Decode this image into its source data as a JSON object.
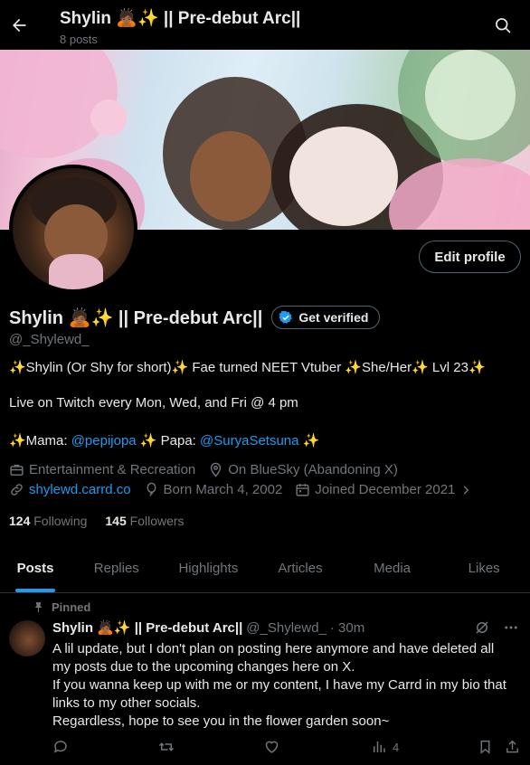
{
  "header": {
    "title": "Shylin 🙇🏾✨ || Pre-debut Arc||",
    "post_count": "8 posts"
  },
  "profile": {
    "edit_label": "Edit profile",
    "display_name": "Shylin 🙇🏾✨ || Pre-debut Arc||",
    "verify_label": "Get verified",
    "handle": "@_Shylewd_",
    "bio": {
      "line1": "✨Shylin (Or Shy for short)✨ Fae turned NEET Vtuber ✨She/Her✨ Lvl 23✨",
      "line2": "Live on Twitch every Mon, Wed, and Fri @ 4 pm",
      "line3_prefix": "✨Mama: ",
      "mama": "@pepijopa",
      "line3_mid": " ✨ Papa: ",
      "papa": "@SuryaSetsuna",
      "line3_suffix": " ✨"
    },
    "meta": {
      "category": "Entertainment & Recreation",
      "location": "On BlueSky (Abandoning X)",
      "website": "shylewd.carrd.co",
      "birthday": "Born March 4, 2002",
      "joined": "Joined December 2021"
    },
    "following_count": "124",
    "following_label": "Following",
    "followers_count": "145",
    "followers_label": "Followers"
  },
  "tabs": [
    "Posts",
    "Replies",
    "Highlights",
    "Articles",
    "Media",
    "Likes"
  ],
  "post": {
    "pinned_label": "Pinned",
    "name": "Shylin 🙇🏾✨ || Pre-debut Arc||",
    "handle": "@_Shylewd_",
    "time": "· 30m",
    "lines": [
      "A lil update, but I don't plan on posting here anymore and have deleted all",
      "my posts due to the upcoming changes here on X.",
      "If you wanna keep up with me or my content, I have my Carrd in my bio that",
      "links to my other socials.",
      "Regardless, hope to see you in the flower garden soon~"
    ],
    "views": "4"
  },
  "colors": {
    "accent": "#1d9bf0",
    "muted": "#71767b",
    "text": "#e7e9ea",
    "border": "#2f3336"
  },
  "icons": [
    "back-arrow-icon",
    "search-icon",
    "verified-badge-icon",
    "briefcase-icon",
    "location-icon",
    "link-icon",
    "balloon-icon",
    "calendar-icon",
    "chevron-right-icon",
    "pin-icon",
    "grok-icon",
    "more-icon",
    "reply-icon",
    "repost-icon",
    "like-icon",
    "views-icon",
    "bookmark-icon",
    "share-icon"
  ]
}
